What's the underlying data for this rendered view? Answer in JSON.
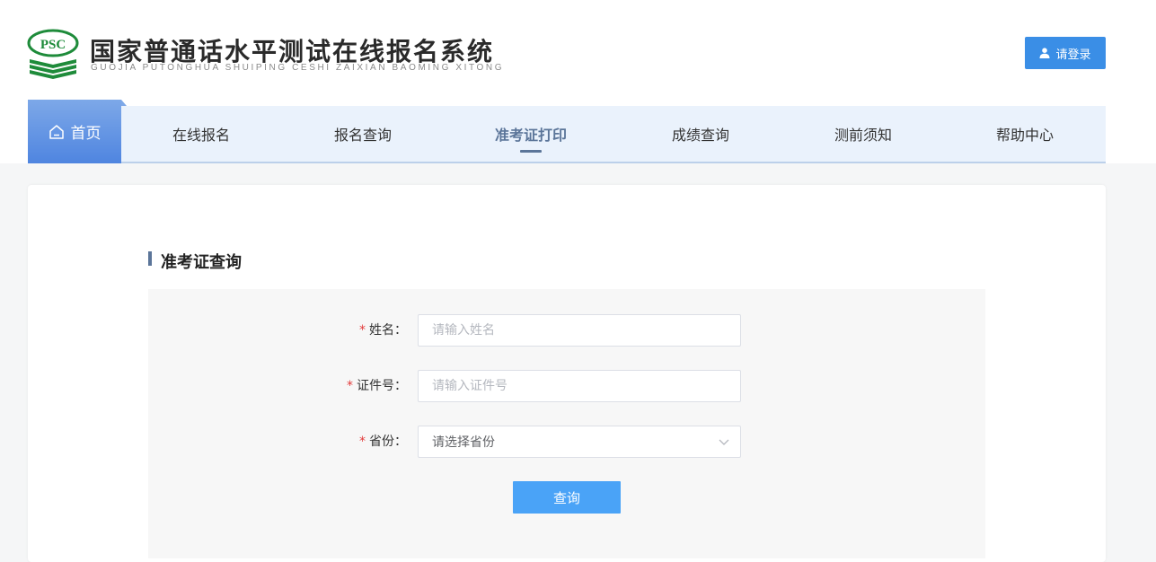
{
  "header": {
    "logo_text": "PSC",
    "title": "国家普通话水平测试在线报名系统",
    "subtitle": "GUOJIA PUTONGHUA SHUIPING CESHI ZAIXIAN BAOMING XITONG",
    "login_label": "请登录"
  },
  "nav": {
    "home_label": "首页",
    "items": [
      {
        "label": "在线报名"
      },
      {
        "label": "报名查询"
      },
      {
        "label": "准考证打印"
      },
      {
        "label": "成绩查询"
      },
      {
        "label": "测前须知"
      },
      {
        "label": "帮助中心"
      }
    ],
    "active_index": 2
  },
  "form": {
    "section_title": "准考证查询",
    "required_mark": "*",
    "name": {
      "label": "姓名：",
      "placeholder": "请输入姓名",
      "value": ""
    },
    "id_number": {
      "label": "证件号：",
      "placeholder": "请输入证件号",
      "value": ""
    },
    "province": {
      "label": "省份：",
      "placeholder": "请选择省份",
      "value": ""
    },
    "submit_label": "查询"
  },
  "colors": {
    "accent": "#3a8ee6",
    "nav_active": "#5b7599",
    "submit": "#4aa3f7",
    "required": "#e23b3b",
    "logo_green": "#1e8b3a"
  }
}
